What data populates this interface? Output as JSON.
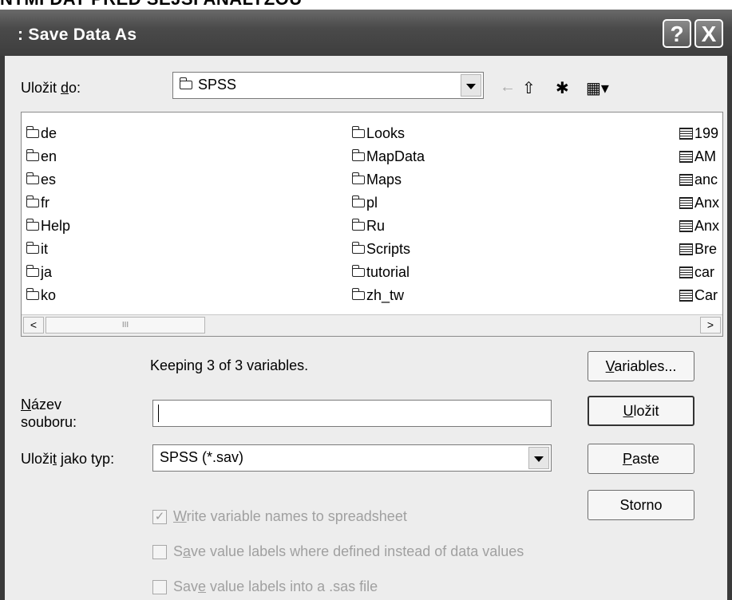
{
  "page_heading": "NTMI DAT PRED SEJSI ANALYZOU",
  "window": {
    "title": ": Save Data As",
    "help_label": "?",
    "close_label": "X"
  },
  "save_in": {
    "label_pre": "Uložit ",
    "label_key": "d",
    "label_post": "o:",
    "value": "SPSS"
  },
  "toolbar": {
    "back": "←",
    "up_folder": "⇧",
    "new_folder": "✱",
    "view_menu": "▦▾"
  },
  "files": {
    "col1": [
      "de",
      "en",
      "es",
      "fr",
      "Help",
      "it",
      "ja",
      "ko"
    ],
    "col2": [
      "Looks",
      "MapData",
      "Maps",
      "pl",
      "Ru",
      "Scripts",
      "tutorial",
      "zh_tw"
    ],
    "col3": [
      "199",
      "AM",
      "anc",
      "Anx",
      "Anx",
      "Bre",
      "car",
      "Car"
    ]
  },
  "scrollbar": {
    "left": "<",
    "right": ">",
    "grip": "III"
  },
  "keeping_text": "Keeping 3 of 3 variables.",
  "filename": {
    "label_key": "N",
    "label_line1": "ázev",
    "label_line2": "souboru:",
    "value": ""
  },
  "save_type": {
    "label_pre": "Uloži",
    "label_key": "t",
    "label_post": " jako typ:",
    "value": "SPSS (*.sav)"
  },
  "buttons": {
    "variables": {
      "key": "V",
      "rest": "ariables..."
    },
    "save": {
      "key": "U",
      "rest": "ložit"
    },
    "paste": {
      "key": "P",
      "rest": "aste"
    },
    "cancel": {
      "label": "Storno"
    }
  },
  "options": [
    {
      "pre": "",
      "key": "W",
      "post": "rite variable names to spreadsheet",
      "checked": true,
      "mark": "✓"
    },
    {
      "pre": "S",
      "key": "a",
      "post": "ve value labels where defined instead of data values",
      "checked": false,
      "mark": ""
    },
    {
      "pre": "Sav",
      "key": "e",
      "post": " value labels into a .sas file",
      "checked": false,
      "mark": ""
    }
  ]
}
